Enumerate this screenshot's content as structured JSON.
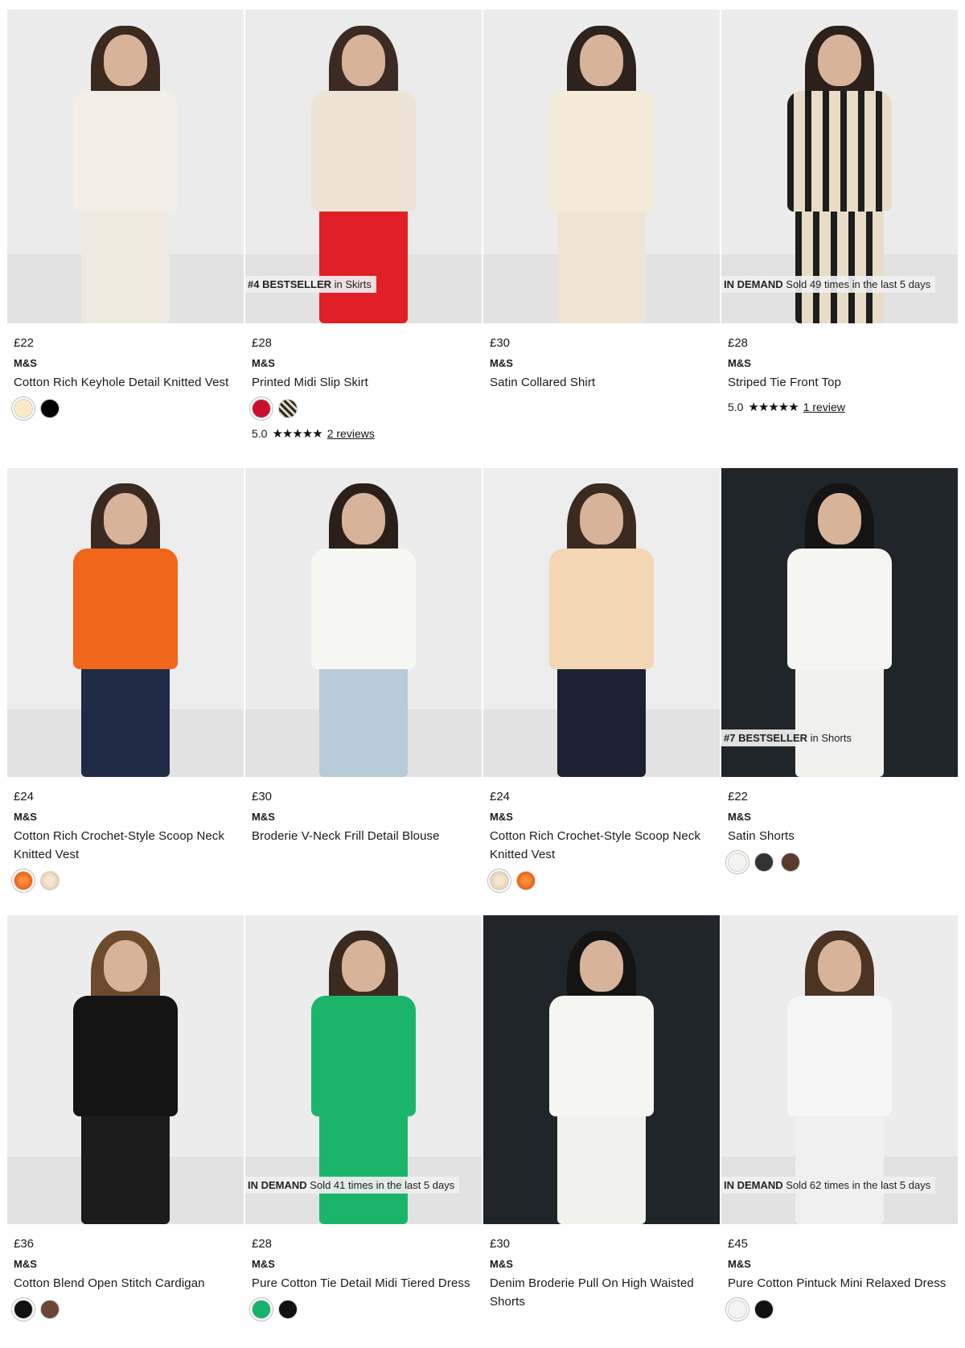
{
  "products": [
    {
      "price": "£22",
      "brand": "M&S",
      "name": "Cotton Rich Keyhole Detail Knitted Vest",
      "image_alt": "model-white-vest",
      "badge": null,
      "outfit": {
        "top": "#f3efe6",
        "bottom": "#efeae0",
        "bg": "#ececec",
        "hair": "#3a2a20"
      },
      "swatches": [
        {
          "color": "#fbe9c7",
          "selected": true
        },
        {
          "color": "#000000"
        }
      ],
      "rating": null
    },
    {
      "price": "£28",
      "brand": "M&S",
      "name": "Printed Midi Slip Skirt",
      "image_alt": "model-red-skirt",
      "badge": {
        "strong": "#4 BESTSELLER",
        "rest": " in Skirts"
      },
      "outfit": {
        "top": "#ede4d6",
        "bottom": "#e01f26",
        "bg": "#ebebeb",
        "hair": "#3b2b22"
      },
      "swatches": [
        {
          "color": "#c8102e",
          "selected": true
        },
        {
          "pattern": "stripe"
        }
      ],
      "rating": {
        "score": "5.0",
        "stars": "★★★★★",
        "reviews": "2 reviews"
      }
    },
    {
      "price": "£30",
      "brand": "M&S",
      "name": "Satin Collared Shirt",
      "image_alt": "model-cream-shirt",
      "badge": null,
      "outfit": {
        "top": "#f4ebd9",
        "bottom": "#efe5d4",
        "bg": "#ececec",
        "hair": "#2e221c"
      },
      "swatches": [],
      "rating": null
    },
    {
      "price": "£28",
      "brand": "M&S",
      "name": "Striped Tie Front Top",
      "image_alt": "model-striped-set",
      "badge": {
        "strong": "IN DEMAND",
        "rest": " Sold 49 times in the last 5 days"
      },
      "outfit": {
        "top": "stripe",
        "bottom": "stripe",
        "bg": "#ececec",
        "hair": "#2c201a"
      },
      "swatches": [],
      "rating": {
        "score": "5.0",
        "stars": "★★★★★",
        "reviews": "1 review"
      }
    },
    {
      "price": "£24",
      "brand": "M&S",
      "name": "Cotton Rich Crochet-Style Scoop Neck Knitted Vest",
      "image_alt": "model-orange-vest",
      "badge": null,
      "outfit": {
        "top": "#f0661a",
        "bottom": "#1f2b45",
        "bg": "#ededed",
        "hair": "#3b2a20"
      },
      "swatches": [
        {
          "pattern": "knit-o",
          "selected": true
        },
        {
          "pattern": "knit-c"
        }
      ],
      "rating": null
    },
    {
      "price": "£30",
      "brand": "M&S",
      "name": "Broderie V-Neck Frill Detail Blouse",
      "image_alt": "model-white-blouse",
      "badge": null,
      "outfit": {
        "top": "#f7f7f4",
        "bottom": "#b8cbd8",
        "bg": "#ececec",
        "hair": "#2b2019"
      },
      "swatches": [],
      "rating": null
    },
    {
      "price": "£24",
      "brand": "M&S",
      "name": "Cotton Rich Crochet-Style Scoop Neck Knitted Vest",
      "image_alt": "model-cream-vest",
      "badge": null,
      "outfit": {
        "top": "#f3d6b4",
        "bottom": "#1b2130",
        "bg": "#ededed",
        "hair": "#3b2a20"
      },
      "swatches": [
        {
          "pattern": "knit-c",
          "selected": true
        },
        {
          "pattern": "knit-o"
        }
      ],
      "rating": null
    },
    {
      "price": "£22",
      "brand": "M&S",
      "name": "Satin Shorts",
      "image_alt": "model-white-shorts",
      "badge": {
        "strong": "#7 BESTSELLER",
        "rest": " in Shorts"
      },
      "outfit": {
        "top": "#f5f5f2",
        "bottom": "#f1f1ee",
        "bg": "dark",
        "hair": "#141414"
      },
      "swatches": [
        {
          "color": "#f4f3ee",
          "selected": true
        },
        {
          "color": "#333333"
        },
        {
          "color": "#5a3a2c"
        }
      ],
      "rating": null
    },
    {
      "price": "£36",
      "brand": "M&S",
      "name": "Cotton Blend Open Stitch Cardigan",
      "image_alt": "model-black-cardigan",
      "badge": null,
      "outfit": {
        "top": "#141414",
        "bottom": "#1c1c1c",
        "bg": "#ececec",
        "hair": "#6b4a2e"
      },
      "swatches": [
        {
          "color": "#111111",
          "selected": true
        },
        {
          "color": "#6b4634"
        }
      ],
      "rating": null
    },
    {
      "price": "£28",
      "brand": "M&S",
      "name": "Pure Cotton Tie Detail Midi Tiered Dress",
      "image_alt": "model-green-dress",
      "badge": {
        "strong": "IN DEMAND",
        "rest": " Sold 41 times in the last 5 days"
      },
      "outfit": {
        "top": "#1bb56a",
        "bottom": "#1bb56a",
        "bg": "#ececec",
        "hair": "#3b2a20"
      },
      "swatches": [
        {
          "color": "#16b26b",
          "selected": true
        },
        {
          "color": "#111111"
        }
      ],
      "rating": null
    },
    {
      "price": "£30",
      "brand": "M&S",
      "name": "Denim Broderie Pull On High Waisted Shorts",
      "image_alt": "model-white-broderie",
      "badge": null,
      "outfit": {
        "top": "#f5f5f2",
        "bottom": "#f1f1ee",
        "bg": "dark",
        "hair": "#141414"
      },
      "swatches": [],
      "rating": null
    },
    {
      "price": "£45",
      "brand": "M&S",
      "name": "Pure Cotton Pintuck Mini Relaxed Dress",
      "image_alt": "model-white-dress",
      "badge": {
        "strong": "IN DEMAND",
        "rest": " Sold 62 times in the last 5 days"
      },
      "outfit": {
        "top": "#f6f6f6",
        "bottom": "#f0f0f0",
        "bg": "#ececec",
        "hair": "#4b3423"
      },
      "swatches": [
        {
          "color": "#f3f3f3",
          "selected": true
        },
        {
          "color": "#111111"
        }
      ],
      "rating": null
    }
  ]
}
